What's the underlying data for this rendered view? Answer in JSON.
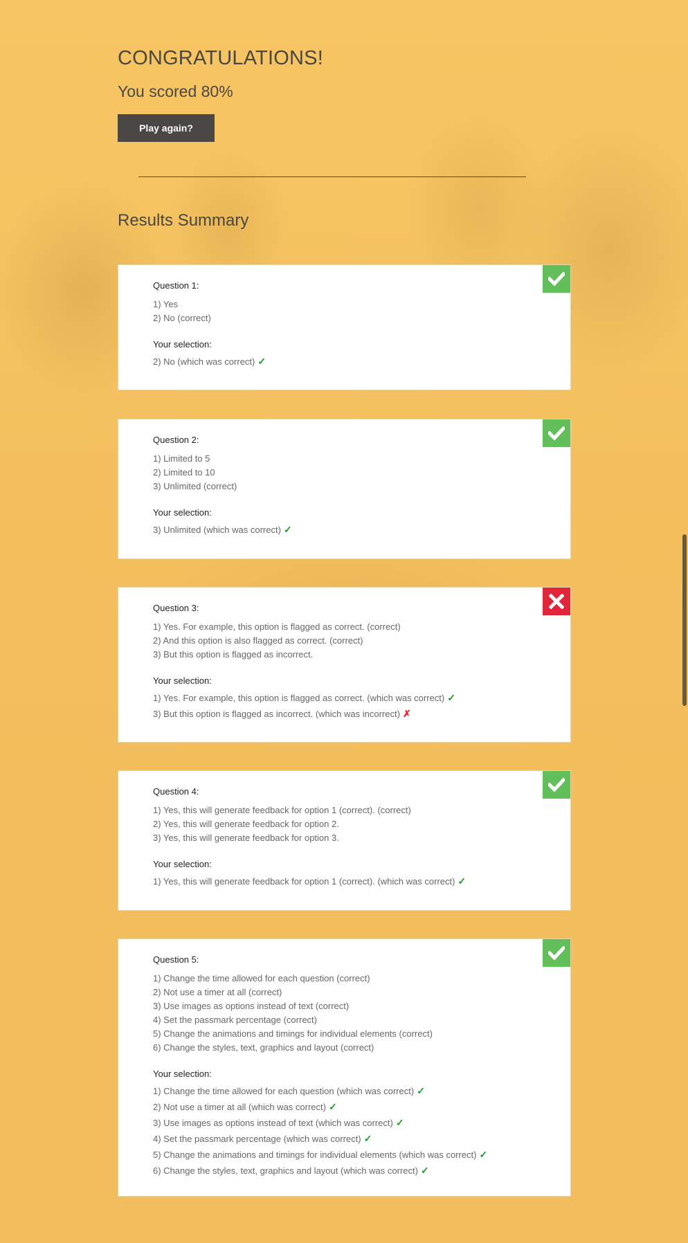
{
  "header": {
    "congrats": "CONGRATULATIONS!",
    "score": "You scored 80%",
    "play_again": "Play again?"
  },
  "summary_title": "Results Summary",
  "colors": {
    "background": "#f2bd5c",
    "correct_badge": "#62bf5a",
    "incorrect_badge": "#e3253b",
    "button": "#4a4744"
  },
  "selection_label": "Your selection:",
  "questions": [
    {
      "title": "Question 1:",
      "status": "correct",
      "options": [
        "1) Yes",
        "2) No (correct)"
      ],
      "selections": [
        {
          "text": "2) No (which was correct)",
          "result": "correct"
        }
      ]
    },
    {
      "title": "Question 2:",
      "status": "correct",
      "options": [
        "1) Limited to 5",
        "2) Limited to 10",
        "3) Unlimited (correct)"
      ],
      "selections": [
        {
          "text": "3) Unlimited (which was correct)",
          "result": "correct"
        }
      ]
    },
    {
      "title": "Question 3:",
      "status": "incorrect",
      "options": [
        "1) Yes. For example, this option is flagged as correct. (correct)",
        "2) And this option is also flagged as correct. (correct)",
        "3) But this option is flagged as incorrect."
      ],
      "selections": [
        {
          "text": "1) Yes. For example, this option is flagged as correct. (which was correct)",
          "result": "correct"
        },
        {
          "text": "3) But this option is flagged as incorrect. (which was incorrect)",
          "result": "incorrect"
        }
      ]
    },
    {
      "title": "Question 4:",
      "status": "correct",
      "options": [
        "1) Yes, this will generate feedback for option 1 (correct). (correct)",
        "2) Yes, this will generate feedback for option 2.",
        "3) Yes, this will generate feedback for option 3."
      ],
      "selections": [
        {
          "text": "1) Yes, this will generate feedback for option 1 (correct). (which was correct)",
          "result": "correct"
        }
      ]
    },
    {
      "title": "Question 5:",
      "status": "correct",
      "options": [
        "1) Change the time allowed for each question (correct)",
        "2) Not use a timer at all (correct)",
        "3) Use images as options instead of text (correct)",
        "4) Set the passmark percentage (correct)",
        "5) Change the animations and timings for individual elements (correct)",
        "6) Change the styles, text, graphics and layout (correct)"
      ],
      "selections": [
        {
          "text": "1) Change the time allowed for each question (which was correct)",
          "result": "correct"
        },
        {
          "text": "2) Not use a timer at all (which was correct)",
          "result": "correct"
        },
        {
          "text": "3) Use images as options instead of text (which was correct)",
          "result": "correct"
        },
        {
          "text": "4) Set the passmark percentage (which was correct)",
          "result": "correct"
        },
        {
          "text": "5) Change the animations and timings for individual elements (which was correct)",
          "result": "correct"
        },
        {
          "text": "6) Change the styles, text, graphics and layout (which was correct)",
          "result": "correct"
        }
      ]
    }
  ]
}
